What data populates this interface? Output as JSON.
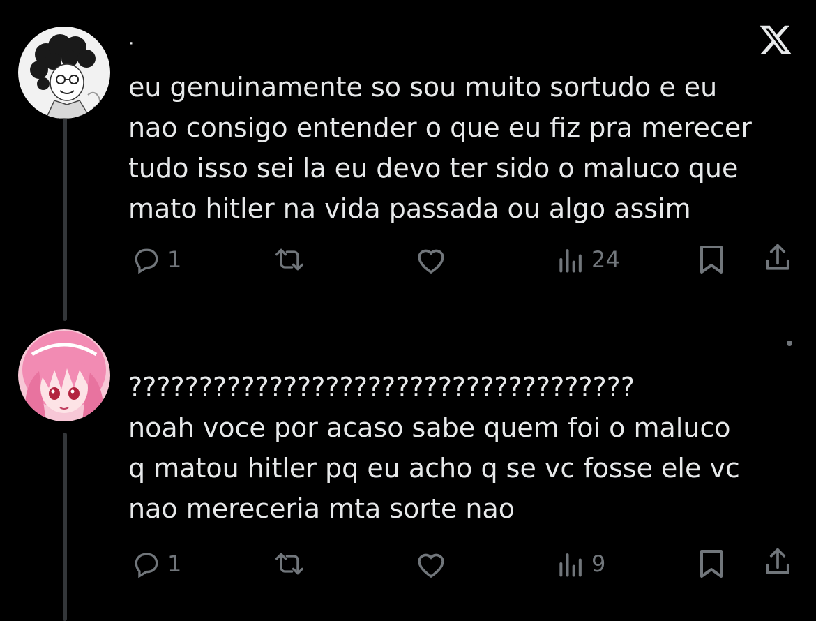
{
  "brand": {
    "logo_icon": "x-logo-icon"
  },
  "posts": [
    {
      "author_display": "·",
      "avatar_icon": "avatar-drawn-curly-hair",
      "text": "eu genuinamente so sou muito sortudo e eu\nnao consigo entender o que eu fiz pra merecer\ntudo isso sei la eu devo ter sido o maluco que\nmato hitler na vida passada ou algo assim",
      "actions": {
        "reply_icon": "reply-icon",
        "reply_count": "1",
        "retweet_icon": "retweet-icon",
        "like_icon": "heart-icon",
        "views_icon": "views-icon",
        "views_count": "24",
        "bookmark_icon": "bookmark-icon",
        "share_icon": "share-icon"
      }
    },
    {
      "author_display": "",
      "avatar_icon": "avatar-pink-hair-anime",
      "text": "????????????????????????????????????\nnoah voce por acaso sabe quem foi o maluco\nq matou hitler pq eu acho q se vc fosse ele vc\nnao mereceria mta sorte nao",
      "actions": {
        "reply_icon": "reply-icon",
        "reply_count": "1",
        "retweet_icon": "retweet-icon",
        "like_icon": "heart-icon",
        "views_icon": "views-icon",
        "views_count": "9",
        "bookmark_icon": "bookmark-icon",
        "share_icon": "share-icon"
      }
    }
  ],
  "colors": {
    "background": "#000000",
    "text": "#e7e9ea",
    "muted": "#71767b",
    "thread_line": "#333639",
    "pink_avatar": "#f4a3c4"
  }
}
